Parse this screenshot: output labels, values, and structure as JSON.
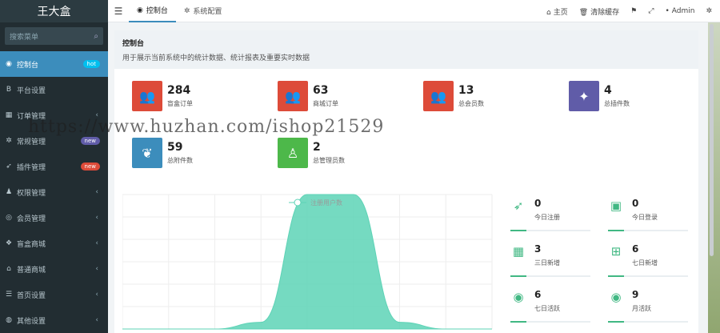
{
  "app": {
    "title": "王大盒"
  },
  "sidebar": {
    "search_placeholder": "搜索菜单",
    "items": [
      {
        "label": "控制台",
        "icon": "dashboard-icon",
        "glyph": "◉",
        "badge": "hot",
        "badge_color": "blue",
        "active": true
      },
      {
        "label": "平台设置",
        "icon": "bold-b-icon",
        "glyph": "B"
      },
      {
        "label": "订单管理",
        "icon": "calculator-icon",
        "glyph": "▦",
        "arrow": "‹"
      },
      {
        "label": "常规管理",
        "icon": "cogs-icon",
        "glyph": "✲",
        "badge": "new",
        "badge_color": "purple"
      },
      {
        "label": "插件管理",
        "icon": "rocket-icon",
        "glyph": "➶",
        "badge": "new",
        "badge_color": "red"
      },
      {
        "label": "权限管理",
        "icon": "users-icon",
        "glyph": "♟",
        "arrow": "‹"
      },
      {
        "label": "会员管理",
        "icon": "user-circle-icon",
        "glyph": "◎",
        "arrow": "‹"
      },
      {
        "label": "盲盒商城",
        "icon": "cubes-icon",
        "glyph": "❖",
        "arrow": "‹"
      },
      {
        "label": "普通商城",
        "icon": "bank-icon",
        "glyph": "⌂",
        "arrow": "‹"
      },
      {
        "label": "首页设置",
        "icon": "list-icon",
        "glyph": "☰",
        "arrow": "‹"
      },
      {
        "label": "其他设置",
        "icon": "dot-circle-icon",
        "glyph": "◍",
        "arrow": "‹"
      }
    ]
  },
  "topbar": {
    "tabs": [
      {
        "label": "控制台",
        "active": true
      },
      {
        "label": "系统配置",
        "active": false
      }
    ],
    "home": "主页",
    "clear_cache": "清除缓存",
    "user": "Admin"
  },
  "page": {
    "title": "控制台",
    "subtitle": "用于展示当前系统中的统计数据、统计报表及重要实时数据"
  },
  "stats": [
    {
      "value": "284",
      "label": "盲盒订单",
      "color": "#dd4b39",
      "icon": "users-icon"
    },
    {
      "value": "63",
      "label": "商城订单",
      "color": "#dd4b39",
      "icon": "users-icon"
    },
    {
      "value": "13",
      "label": "总会员数",
      "color": "#dd4b39",
      "icon": "users-icon"
    },
    {
      "value": "4",
      "label": "总插件数",
      "color": "#605ca8",
      "icon": "magic-wand-icon"
    },
    {
      "value": "59",
      "label": "总附件数",
      "color": "#3c8dbc",
      "icon": "leaf-icon"
    },
    {
      "value": "2",
      "label": "总管理员数",
      "color": "#4db84a",
      "icon": "user-icon"
    }
  ],
  "mini_stats": [
    {
      "value": "0",
      "label": "今日注册",
      "icon": "rocket-icon",
      "glyph": "➶"
    },
    {
      "value": "0",
      "label": "今日登录",
      "icon": "id-card-icon",
      "glyph": "▣"
    },
    {
      "value": "3",
      "label": "三日新增",
      "icon": "calendar-icon",
      "glyph": "▦"
    },
    {
      "value": "6",
      "label": "七日新增",
      "icon": "calendar-plus-icon",
      "glyph": "⊞"
    },
    {
      "value": "6",
      "label": "七日活跃",
      "icon": "user-circle-icon",
      "glyph": "◉"
    },
    {
      "value": "9",
      "label": "月活跃",
      "icon": "user-circle-icon",
      "glyph": "◉"
    }
  ],
  "chart_data": {
    "type": "area",
    "legend": "注册用户数",
    "color": "#5dd3b6",
    "values": [
      0,
      0,
      0,
      0.05,
      1,
      1,
      0.05,
      0,
      0
    ]
  },
  "watermark": "https://www.huzhan.com/ishop21529"
}
